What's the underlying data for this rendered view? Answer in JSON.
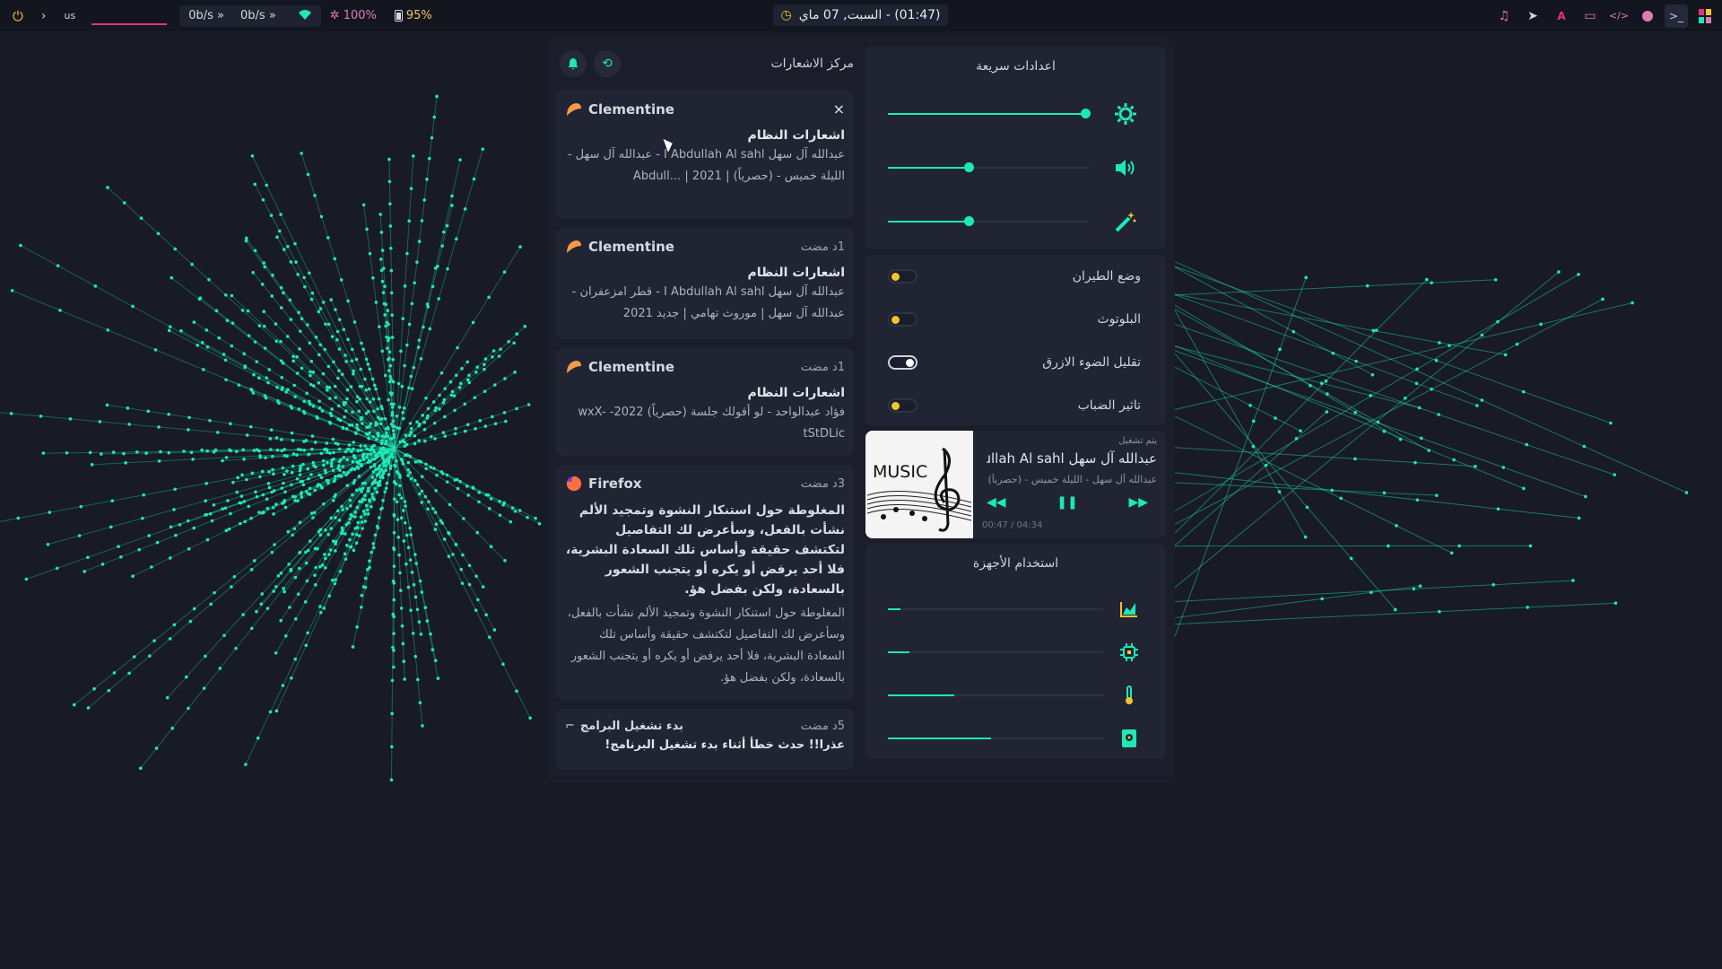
{
  "topbar": {
    "power_icon": "power-icon",
    "keyboard_layout": "us",
    "net_down": "0b/s",
    "net_up": "0b/s",
    "brightness": "100%",
    "battery": "95%",
    "clock": "(01:47) - السبت, 07 ماي",
    "tray_icons": [
      "music-icon",
      "telegram-icon",
      "font-icon",
      "folder-icon",
      "code-icon",
      "color-picker-icon",
      "terminal-icon",
      "palette-icon"
    ]
  },
  "notifications": {
    "title": "مركز الاشعارات",
    "cards": [
      {
        "app": "Clementine",
        "close": "×",
        "title": "اشعارات النظام",
        "body": "عبدالله آل سهل I Abdullah Al sahl - عبدالله آل سهل - الليلة خميس - (حصرياً) | 2021 | ...Abdull"
      },
      {
        "app": "Clementine",
        "time": "1د مضت",
        "title": "اشعارات النظام",
        "body": "عبدالله آل سهل I Abdullah Al sahl - قطر امزعفران - عبدالله آل سهل | موروث تهامي | جديد 2021"
      },
      {
        "app": "Clementine",
        "time": "1د مضت",
        "title": "اشعارات النظام",
        "body": "فؤاد عبدالواحد - لو أقولك جلسة (حصرياً) 2022- wxX-tStDLic"
      },
      {
        "app": "Firefox",
        "time": "3د مضت",
        "title": "المغلوطة حول استنكار  النشوة وتمجيد الألم نشأت بالفعل، وسأعرض لك التفاصيل لتكتشف حقيقة وأساس تلك السعادة البشرية، فلا أحد يرفض أو يكره أو يتجنب الشعور بالسعادة، ولكن بفضل هؤ.",
        "body": "المغلوطة حول استنكار  النشوة وتمجيد الألم نشأت بالفعل، وسأعرض لك التفاصيل لتكتشف حقيقة وأساس تلك السعادة البشرية، فلا أحد يرفض أو يكره أو يتجنب الشعور بالسعادة، ولكن بفضل هؤ."
      },
      {
        "app": "بدء تشغيل البرامج",
        "time": "5د مضت",
        "title": "عذرا!! حدث خطأ أثناء بدء تشغيل البرنامج!"
      }
    ]
  },
  "quick_settings": {
    "title": "اعدادات سريعة",
    "sliders": [
      {
        "name": "brightness",
        "icon": "brightness-icon",
        "level": 0.98
      },
      {
        "name": "volume",
        "icon": "volume-icon",
        "level": 0.4
      },
      {
        "name": "effects",
        "icon": "magic-wand-icon",
        "level": 0.4
      }
    ],
    "toggles": [
      {
        "label": "وضع الطيران",
        "on": false
      },
      {
        "label": "البلوتوث",
        "on": false
      },
      {
        "label": "تقليل الضوء الازرق",
        "on": true
      },
      {
        "label": "تاثير الضباب",
        "on": false
      }
    ]
  },
  "player": {
    "status": "يتم تشغيل",
    "title": "عبدالله آل سهل I Abdullah Al sahl",
    "artist": "عبدالله آل سهل - الليلة خميس - (حصرياً)",
    "position": "00:47",
    "duration": "04:34",
    "time": "00:47 / 04:34",
    "album_text": "MUSIC",
    "progress": 0.17
  },
  "usage": {
    "title": "استخدام الأجهزة",
    "rows": [
      {
        "name": "network",
        "icon": "chart-icon",
        "level": 0.06
      },
      {
        "name": "cpu",
        "icon": "cpu-icon",
        "level": 0.1
      },
      {
        "name": "temperature",
        "icon": "thermometer-icon",
        "level": 0.31
      },
      {
        "name": "disk",
        "icon": "disk-icon",
        "level": 0.48
      }
    ]
  },
  "colors": {
    "accent": "#1de9b6",
    "yellow": "#f4c430",
    "background": "#181a25",
    "panel": "#1b1e2a",
    "card": "#212433"
  }
}
